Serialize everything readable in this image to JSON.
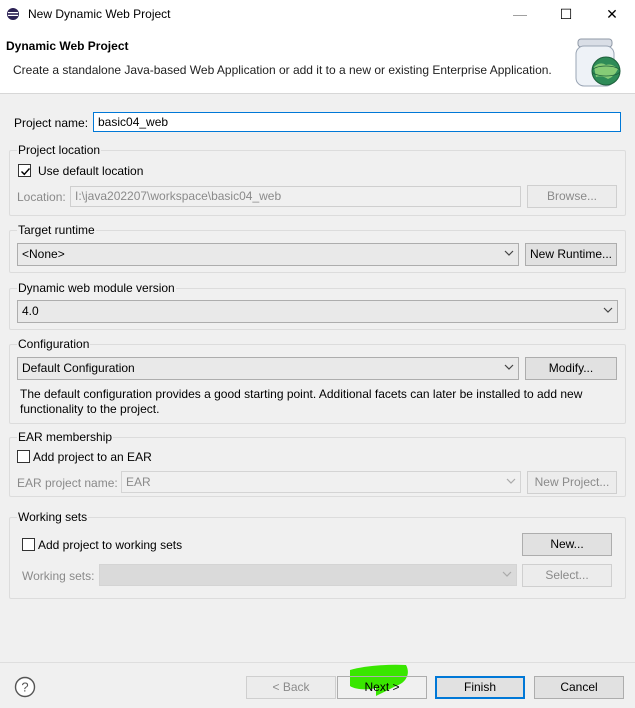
{
  "window": {
    "title": "New Dynamic Web Project",
    "minimize_glyph": "—",
    "maximize_glyph": "☐",
    "close_glyph": "✕"
  },
  "banner": {
    "heading": "Dynamic Web Project",
    "description": "Create a standalone Java-based Web Application or add it to a new or existing Enterprise Application.",
    "icon": "web-project-jar-globe-icon"
  },
  "project_name": {
    "label": "Project name:",
    "value": "basic04_web"
  },
  "project_location": {
    "title": "Project location",
    "use_default_label": "Use default location",
    "use_default_checked": true,
    "location_label": "Location:",
    "location_value": "I:\\java202207\\workspace\\basic04_web",
    "browse_label": "Browse..."
  },
  "target_runtime": {
    "title": "Target runtime",
    "selected": "<None>",
    "new_runtime_label": "New Runtime..."
  },
  "module_version": {
    "title": "Dynamic web module version",
    "selected": "4.0"
  },
  "configuration": {
    "title": "Configuration",
    "selected": "Default Configuration",
    "modify_label": "Modify...",
    "description_line1": "The default configuration provides a good starting point. Additional facets can later be installed to add new",
    "description_line2": "functionality to the project."
  },
  "ear_membership": {
    "title": "EAR membership",
    "add_label": "Add project to an EAR",
    "add_checked": false,
    "ear_name_label": "EAR project name:",
    "ear_name_value": "EAR",
    "new_project_label": "New Project..."
  },
  "working_sets": {
    "title": "Working sets",
    "add_label": "Add project to working sets",
    "add_checked": false,
    "new_label": "New...",
    "sets_label": "Working sets:",
    "sets_value": "",
    "select_label": "Select..."
  },
  "footer": {
    "help_glyph": "?",
    "back_label": "< Back",
    "next_label": "Next >",
    "finish_label": "Finish",
    "cancel_label": "Cancel"
  },
  "colors": {
    "focus_border": "#0078d7",
    "highlight_marker": "#39e600",
    "globe": "#2e8b57"
  }
}
